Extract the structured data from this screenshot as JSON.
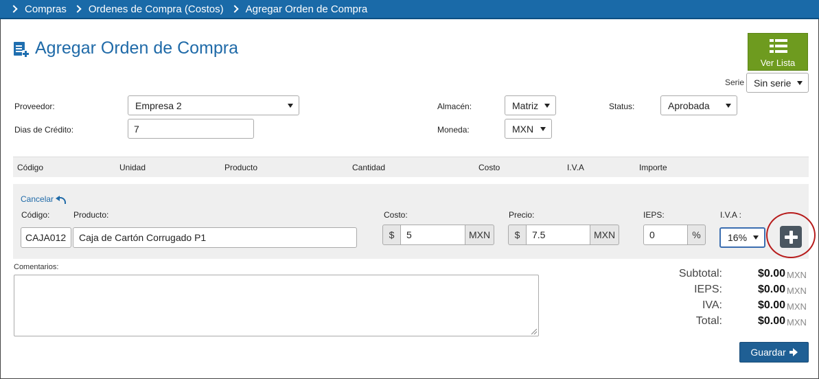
{
  "breadcrumb": [
    "Compras",
    "Ordenes de Compra (Costos)",
    "Agregar Orden de Compra"
  ],
  "page_title": "Agregar Orden de Compra",
  "ver_lista_label": "Ver Lista",
  "serie": {
    "label": "Serie",
    "value": "Sin serie"
  },
  "form": {
    "proveedor": {
      "label": "Proveedor:",
      "value": "Empresa 2"
    },
    "dias_credito": {
      "label": "Dias de Crédito:",
      "value": "7"
    },
    "almacen": {
      "label": "Almacén:",
      "value": "Matriz"
    },
    "moneda": {
      "label": "Moneda:",
      "value": "MXN"
    },
    "status": {
      "label": "Status:",
      "value": "Aprobada"
    }
  },
  "table_headers": [
    "Código",
    "Unidad",
    "Producto",
    "Cantidad",
    "Costo",
    "I.V.A",
    "Importe"
  ],
  "entry": {
    "cancelar": "Cancelar",
    "codigo": {
      "label": "Código:",
      "value": "CAJA012"
    },
    "producto": {
      "label": "Producto:",
      "value": "Caja de Cartón Corrugado P1"
    },
    "costo": {
      "label": "Costo:",
      "prefix": "$",
      "value": "5",
      "suffix": "MXN"
    },
    "precio": {
      "label": "Precio:",
      "prefix": "$",
      "value": "7.5",
      "suffix": "MXN"
    },
    "ieps": {
      "label": "IEPS:",
      "value": "0",
      "suffix": "%"
    },
    "iva": {
      "label": "I.V.A :",
      "value": "16%"
    }
  },
  "comentarios_label": "Comentarios:",
  "totals": [
    {
      "label": "Subtotal:",
      "value": "$0.00",
      "currency": "MXN"
    },
    {
      "label": "IEPS:",
      "value": "$0.00",
      "currency": "MXN"
    },
    {
      "label": "IVA:",
      "value": "$0.00",
      "currency": "MXN"
    },
    {
      "label": "Total:",
      "value": "$0.00",
      "currency": "MXN"
    }
  ],
  "guardar_label": "Guardar",
  "colors": {
    "breadcrumb_bar": "#1a6aa8",
    "ver_lista": "#6e9b1f",
    "guardar": "#1f5f94",
    "highlight_circle": "#b71c1c"
  }
}
